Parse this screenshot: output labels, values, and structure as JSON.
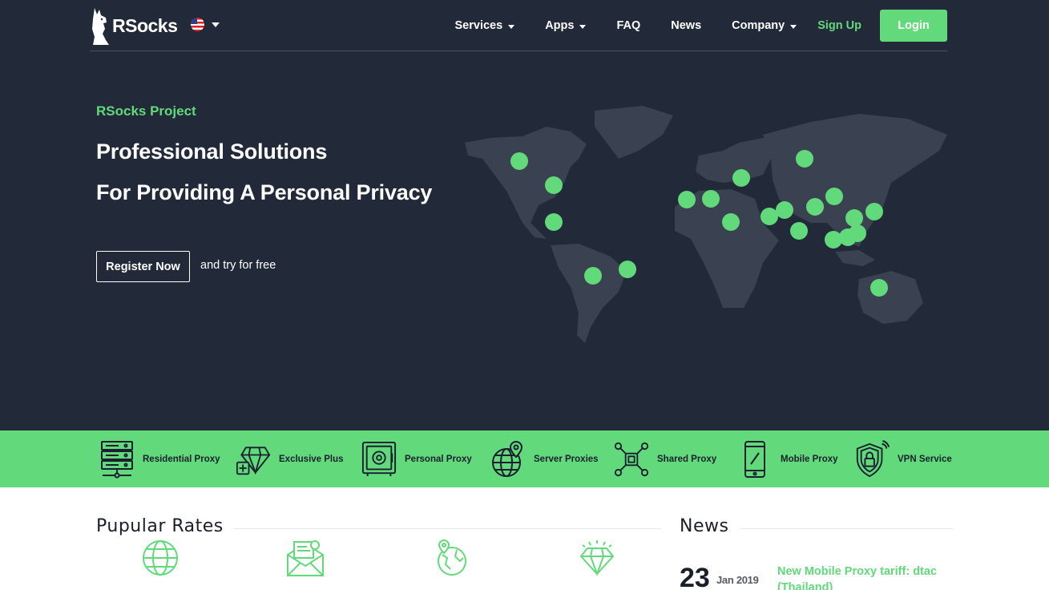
{
  "brand": {
    "name": "RSocks",
    "language": "en-US",
    "accent": "#62d97a",
    "hero_bg": "#222a39"
  },
  "nav": {
    "services": "Services",
    "apps": "Apps",
    "faq": "FAQ",
    "news": "News",
    "company": "Company",
    "signup": "Sign Up",
    "login": "Login"
  },
  "hero": {
    "label": "RSocks Project",
    "title_line1": "Professional Solutions",
    "title_line2": "For Providing A Personal Privacy",
    "register_button": "Register Now",
    "register_note": "and try for free"
  },
  "services": [
    {
      "label": "Residential Proxy",
      "icon": "server-rack-icon"
    },
    {
      "label": "Exclusive Plus",
      "icon": "diamond-plus-icon"
    },
    {
      "label": "Personal Proxy",
      "icon": "safe-icon"
    },
    {
      "label": "Server Proxies",
      "icon": "globe-pin-icon"
    },
    {
      "label": "Shared Proxy",
      "icon": "chip-network-icon"
    },
    {
      "label": "Mobile Proxy",
      "icon": "mobile-phone-icon"
    },
    {
      "label": "VPN Service",
      "icon": "shield-lock-icon"
    }
  ],
  "rates": {
    "title": "Pupular Rates",
    "icons": [
      "globe-icon",
      "envelope-icon",
      "earth-pin-icon",
      "diamond-icon"
    ]
  },
  "news": {
    "title": "News",
    "items": [
      {
        "day": "23",
        "month_year": "Jan 2019",
        "headline": "New Mobile Proxy tariff: dtac (Thailand)"
      }
    ]
  }
}
